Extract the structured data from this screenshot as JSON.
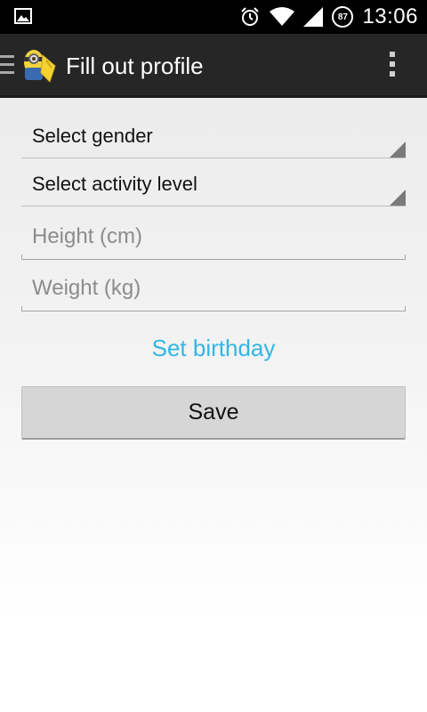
{
  "status_bar": {
    "time": "13:06",
    "battery_level": "87",
    "icons": [
      "image-notification-icon",
      "alarm-icon",
      "wifi-icon",
      "signal-icon",
      "battery-icon"
    ]
  },
  "action_bar": {
    "title": "Fill out profile",
    "icons": [
      "drawer-icon",
      "app-icon",
      "overflow-menu-icon"
    ]
  },
  "form": {
    "gender_spinner": "Select gender",
    "activity_spinner": "Select activity level",
    "height_placeholder": "Height (cm)",
    "weight_placeholder": "Weight (kg)",
    "birthday_link": "Set birthday",
    "save_label": "Save"
  },
  "colors": {
    "accent": "#33b5e5",
    "action_bar": "#262626",
    "status_bar": "#000000"
  }
}
